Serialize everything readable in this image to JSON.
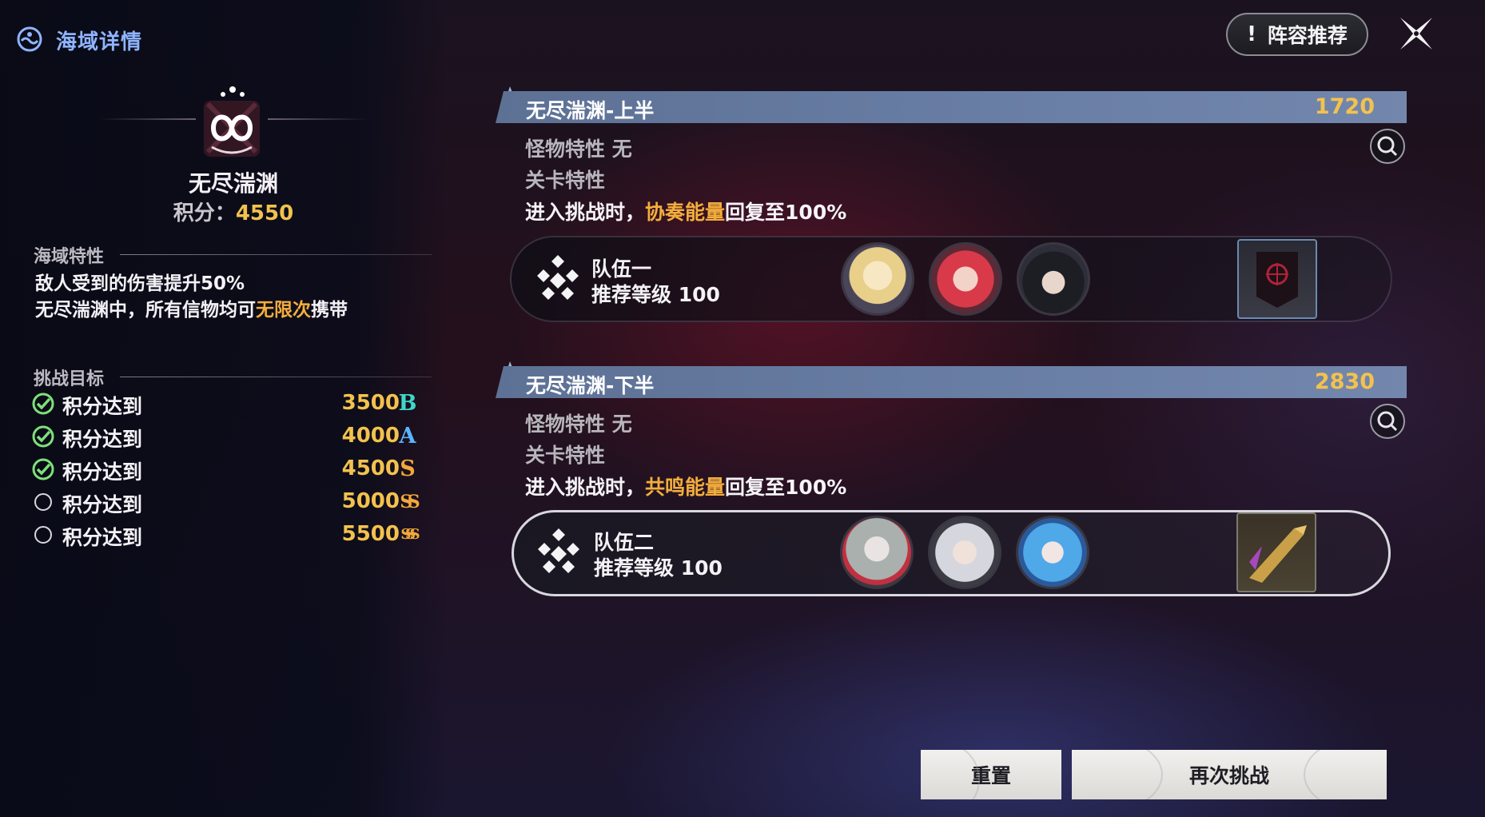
{
  "header": {
    "title": "海域详情",
    "icon": "sea-region-icon"
  },
  "abyss": {
    "name": "无尽湍渊",
    "score_label": "积分：",
    "score_value": "4550",
    "emblem_icon": "infinity-anchor-emblem"
  },
  "sea_traits": {
    "title": "海域特性",
    "line1": "敌人受到的伤害提升50%",
    "line2_before": "无尽湍渊中，所有信物均可",
    "line2_highlight": "无限次",
    "line2_after": "携带"
  },
  "goals": {
    "title": "挑战目标",
    "items": [
      {
        "label": "积分达到",
        "value": "3500",
        "grade": "B",
        "done": true,
        "grade_color": "#3fd6c9"
      },
      {
        "label": "积分达到",
        "value": "4000",
        "grade": "A",
        "done": true,
        "grade_color": "#5ab4ff"
      },
      {
        "label": "积分达到",
        "value": "4500",
        "grade": "S",
        "done": true,
        "grade_color": "#f2a83a"
      },
      {
        "label": "积分达到",
        "value": "5000",
        "grade": "SS",
        "done": false,
        "grade_color": "#f2a83a"
      },
      {
        "label": "积分达到",
        "value": "5500",
        "grade": "SSS",
        "done": false,
        "grade_color": "#f2a83a"
      }
    ]
  },
  "top_right": {
    "formation_button": "阵容推荐",
    "formation_icon": "exclamation-icon",
    "close_icon": "close-x-icon"
  },
  "stages": [
    {
      "name": "无尽湍渊-上半",
      "score": "1720",
      "monster_trait_label": "怪物特性",
      "monster_trait_value": "无",
      "stage_trait_label": "关卡特性",
      "effect_before": "进入挑战时，",
      "effect_highlight": "协奏能量",
      "effect_after": "回复至100%",
      "team": {
        "name": "队伍一",
        "level": "推荐等级 100",
        "avatars": [
          "blonde-flower-crown-avatar",
          "red-horned-avatar",
          "black-hair-avatar"
        ],
        "relic": "dark-banner-relic"
      }
    },
    {
      "name": "无尽湍渊-下半",
      "score": "2830",
      "monster_trait_label": "怪物特性",
      "monster_trait_value": "无",
      "stage_trait_label": "关卡特性",
      "effect_before": "进入挑战时，",
      "effect_highlight": "共鸣能量",
      "effect_after": "回复至100%",
      "team": {
        "name": "队伍二",
        "level": "推荐等级 100",
        "avatars": [
          "grey-hair-avatar",
          "silver-hair-avatar",
          "blue-hair-avatar"
        ],
        "relic": "golden-horn-relic"
      }
    }
  ],
  "buttons": {
    "reset": "重置",
    "retry": "再次挑战"
  },
  "colors": {
    "accent_gold": "#f3c24d",
    "highlight_orange": "#f4ae3c",
    "stage_bar": "#6a7fa6",
    "header_blue": "#8fb4ff"
  }
}
